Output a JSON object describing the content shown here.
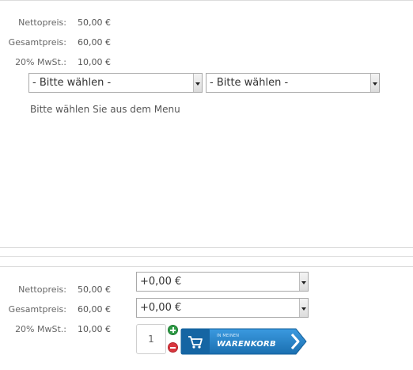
{
  "top_product": {
    "price_labels": [
      "Nettopreis:",
      "Gesamtpreis:",
      "20% MwSt.:"
    ],
    "price_values": [
      "50,00 €",
      "60,00 €",
      "10,00 €"
    ],
    "selects": [
      "- Bitte wählen -",
      "- Bitte wählen -"
    ],
    "hint": "Bitte wählen Sie aus dem Menu"
  },
  "bottom_product": {
    "price_labels": [
      "Nettopreis:",
      "Gesamtpreis:",
      "20% MwSt.:"
    ],
    "price_values": [
      "50,00 €",
      "60,00 €",
      "10,00 €"
    ],
    "selects": [
      "+0,00 €",
      "+0,00 €"
    ],
    "quantity": "1",
    "cart_button": {
      "small_text": "IN MEINEN",
      "big_text": "WARENKORB"
    }
  },
  "colors": {
    "cart_button": "#1f7fc4",
    "plus_button": "#2e9a45",
    "minus_button": "#d9363e"
  },
  "icons": [
    "cart-icon",
    "plus-icon",
    "minus-icon",
    "chevron-right-icon",
    "dropdown-arrow-icon"
  ]
}
